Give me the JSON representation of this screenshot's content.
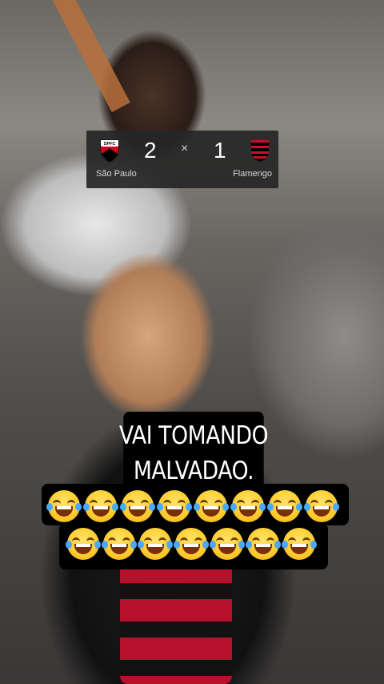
{
  "scoreboard": {
    "home_team": "São Paulo",
    "away_team": "Flamengo",
    "home_score": "2",
    "away_score": "1",
    "separator": "×",
    "home_crest_text": "SPFC",
    "home_crest_colors": [
      "#ffffff",
      "#d6001c",
      "#000000"
    ],
    "away_crest_colors": [
      "#c8102e",
      "#000000"
    ]
  },
  "caption": {
    "line1": "VAI TOMANDO",
    "line2": "MALVADAO.",
    "emoji_name": "face-with-tears-of-joy",
    "row1_count": 8,
    "row2_count": 7
  }
}
